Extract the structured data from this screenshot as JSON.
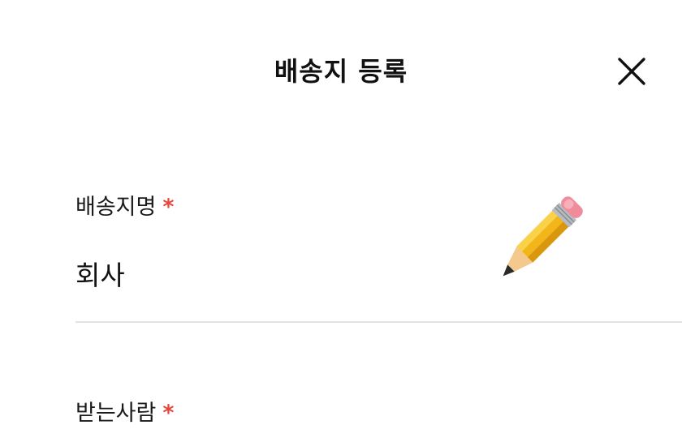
{
  "header": {
    "title": "배송지 등록",
    "close_icon": "close-icon"
  },
  "form": {
    "name_field": {
      "label": "배송지명",
      "required_mark": "*",
      "value": "회사",
      "edit_icon": "pencil-icon"
    },
    "recipient_field": {
      "label": "받는사람",
      "required_mark": "*"
    }
  },
  "colors": {
    "required": "#e5473b",
    "divider": "#e2e2e2",
    "text": "#111111",
    "background": "#ffffff"
  }
}
